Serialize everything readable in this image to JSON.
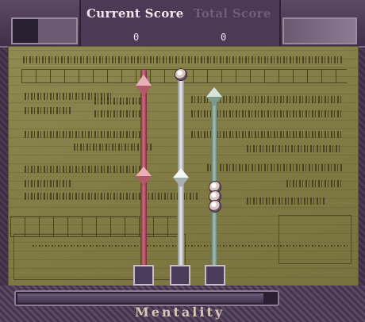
{
  "hud": {
    "current_score_label": "Current Score",
    "current_score_value": "0",
    "total_score_label": "Total Score",
    "total_score_value": "0"
  },
  "meter": {
    "label": "Mentality",
    "fill_fraction": 0.95
  },
  "needles": [
    {
      "name": "red-needle",
      "color": "#c9727d"
    },
    {
      "name": "white-needle",
      "color": "#e6ecea"
    },
    {
      "name": "green-needle",
      "color": "#a6c1b2"
    }
  ]
}
